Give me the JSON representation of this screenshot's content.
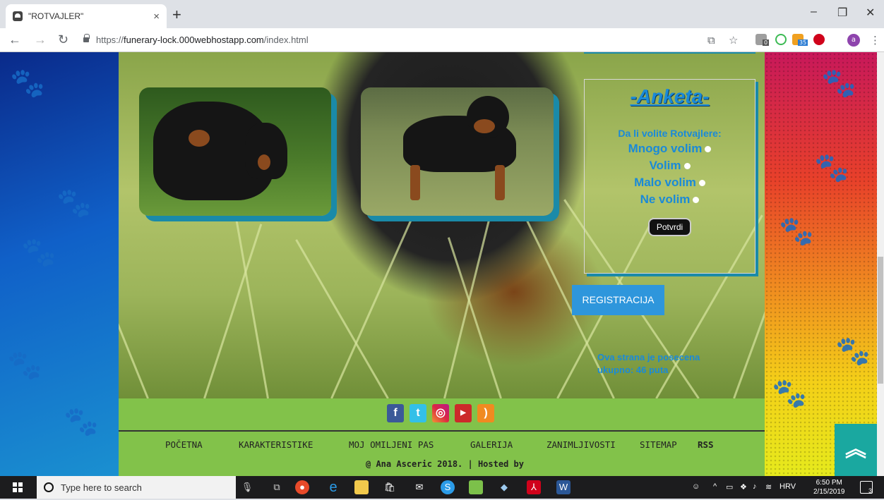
{
  "browser": {
    "tab_title": "\"ROTVAJLER\"",
    "tab_close": "×",
    "new_tab": "+",
    "url_prefix": "https://",
    "url_host": "funerary-lock.000webhostapp.com",
    "url_path": "/index.html",
    "avatar_letter": "a",
    "ext_badge_1": "0",
    "ext_badge_2": "35"
  },
  "poll": {
    "title": "-Anketa-",
    "question": "Da li volite Rotvajlere:",
    "options": [
      "Mnogo volim",
      "Volim",
      "Malo volim",
      "Ne volim"
    ],
    "submit_label": "Potvrdi"
  },
  "registration_label": "REGISTRACIJA",
  "visits_text": "Ova strana je posecena ukupno: 46 puta",
  "footer": {
    "social_icons": [
      "facebook-icon",
      "twitter-icon",
      "instagram-icon",
      "youtube-icon",
      "rss-icon"
    ],
    "nav": [
      "POČETNA",
      "KARAKTERISTIKE",
      "MOJ OMILJENI PAS",
      "GALERIJA",
      "ZANIMLJIVOSTI",
      "SITEMAP",
      "RSS"
    ],
    "copyright": "@ Ana Asceric 2018. | Hosted by"
  },
  "scroll_top_icon": "chevron-double-up-icon",
  "taskbar": {
    "search_placeholder": "Type here to search",
    "language": "HRV",
    "time": "6:50 PM",
    "date": "2/15/2019",
    "notification_count": "3"
  },
  "colors": {
    "accent_blue": "#1a8ad8",
    "footer_green": "#82c24a",
    "photo_border": "#1a8aa8",
    "scroll_top": "#1aa8a0"
  }
}
